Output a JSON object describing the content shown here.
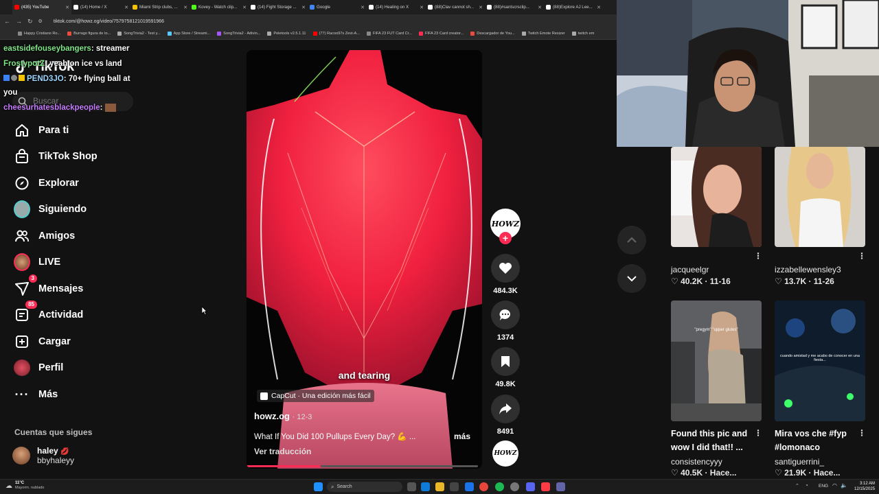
{
  "browser": {
    "tabs": [
      {
        "label": "(435) YouTube",
        "color": "#ff0000"
      },
      {
        "label": "(14) Home / X",
        "color": "#ffffff"
      },
      {
        "label": "Miami Strip clubs, ...",
        "color": "#f5c400"
      },
      {
        "label": "Kovey - Watch clip...",
        "color": "#53fc18"
      },
      {
        "label": "(14) Fight Storage ...",
        "color": "#ffffff"
      },
      {
        "label": "Google",
        "color": "#4285f4"
      },
      {
        "label": "(14) Healing on X",
        "color": "#ffffff"
      },
      {
        "label": "(88)Clav cannot sh...",
        "color": "#ffffff"
      },
      {
        "label": "(88)#santscrsclip...",
        "color": "#ffffff"
      },
      {
        "label": "(88)Explore AJ Lee...",
        "color": "#ffffff"
      }
    ],
    "url": "tiktok.com/@howz.og/video/7579758121019591966",
    "bookmarks": [
      {
        "label": "Happy Cristiano Ro...",
        "color": "#888"
      },
      {
        "label": "Burrago figura de to...",
        "color": "#e74c3c"
      },
      {
        "label": "SongTrivia2 - Test y...",
        "color": "#aaa"
      },
      {
        "label": "App Store / Streami...",
        "color": "#5ac8fa"
      },
      {
        "label": "SongTrivia2 - Adivin...",
        "color": "#a855f7"
      },
      {
        "label": "Peletools v2.5.1.11",
        "color": "#aaa"
      },
      {
        "label": "(77) Racoo97s Zest-A...",
        "color": "#ff0000"
      },
      {
        "label": "FIFA 23 FUT Card Cr...",
        "color": "#888"
      },
      {
        "label": "FIFA 23 Card creator...",
        "color": "#ff2d55"
      },
      {
        "label": "Descargador de You...",
        "color": "#e74c3c"
      },
      {
        "label": "Twitch Emote Resizer",
        "color": "#aaa"
      },
      {
        "label": "twitch em",
        "color": "#aaa"
      }
    ]
  },
  "chat": [
    {
      "user": "eastsidefouseybangers",
      "sep": ":",
      "msg": "streamer",
      "color": "#7ee787"
    },
    {
      "user": "FrostypotZ",
      "sep": ":",
      "msg": "yeah on ice vs land",
      "color": "#7ee787"
    },
    {
      "user": "PEND3JO",
      "sep": ":",
      "msg": "70+ flying ball at",
      "color": "#9ad6ff"
    },
    {
      "user": "",
      "sep": "",
      "msg": "you",
      "color": "#ffffff"
    },
    {
      "user": "cheesurhatesblackpeople",
      "sep": ":",
      "msg": "",
      "color": "#c77dff"
    }
  ],
  "sidebar": {
    "logo": "TikTok",
    "search_placeholder": "Buscar",
    "items": [
      {
        "label": "Para ti",
        "icon": "home-icon"
      },
      {
        "label": "TikTok Shop",
        "icon": "shop-icon"
      },
      {
        "label": "Explorar",
        "icon": "compass-icon"
      },
      {
        "label": "Siguiendo",
        "icon": "following-avatar-icon"
      },
      {
        "label": "Amigos",
        "icon": "friends-icon"
      },
      {
        "label": "LIVE",
        "icon": "live-avatar-icon"
      },
      {
        "label": "Mensajes",
        "icon": "messages-icon",
        "badge": "3"
      },
      {
        "label": "Actividad",
        "icon": "activity-icon",
        "badge": "85"
      },
      {
        "label": "Cargar",
        "icon": "upload-icon"
      },
      {
        "label": "Perfil",
        "icon": "profile-avatar-icon"
      },
      {
        "label": "Más",
        "icon": "more-icon"
      }
    ],
    "following_header": "Cuentas que sigues",
    "following": [
      {
        "name": "haley",
        "emoji": "💋",
        "handle": "bbyhaleyy"
      }
    ]
  },
  "video": {
    "subtitle": "and tearing",
    "capcut_badge": "CapCut · Una edición más fácil",
    "author": "howz.og",
    "date": "· 12-3",
    "caption": "What If You Did 100 Pullups Every Day? 💪  ...",
    "more": "más",
    "translate": "Ver traducción",
    "progress": 0.32
  },
  "actions": {
    "creator_avatar_text": "HOWZ",
    "likes": "484.3K",
    "comments": "1374",
    "saves": "49.8K",
    "shares": "8491"
  },
  "grid": [
    {
      "user": "jacqueelgr",
      "likes": "40.2K · 11-16",
      "title": ""
    },
    {
      "user": "izzabellewensley3",
      "likes": "13.7K · 11-26",
      "title": ""
    },
    {
      "user": "consistencyyy",
      "likes": "40.5K · Hace...",
      "title": "Found this pic and wow I did that!! ...",
      "overlay": "\"pregym\" \"upper glutes\""
    },
    {
      "user": "santiguerrini_",
      "likes": "21.9K · Hace...",
      "title": "Mira vos che #fyp #lomonaco",
      "overlay": "cuando amistad y me acabo de conocer en una fiesta..."
    }
  ],
  "taskbar": {
    "weather": "11°C",
    "weather_desc": "Mayorm. nublado",
    "search": "Search",
    "lang": "ENG",
    "time": "3:12 AM",
    "date": "12/15/2025"
  }
}
